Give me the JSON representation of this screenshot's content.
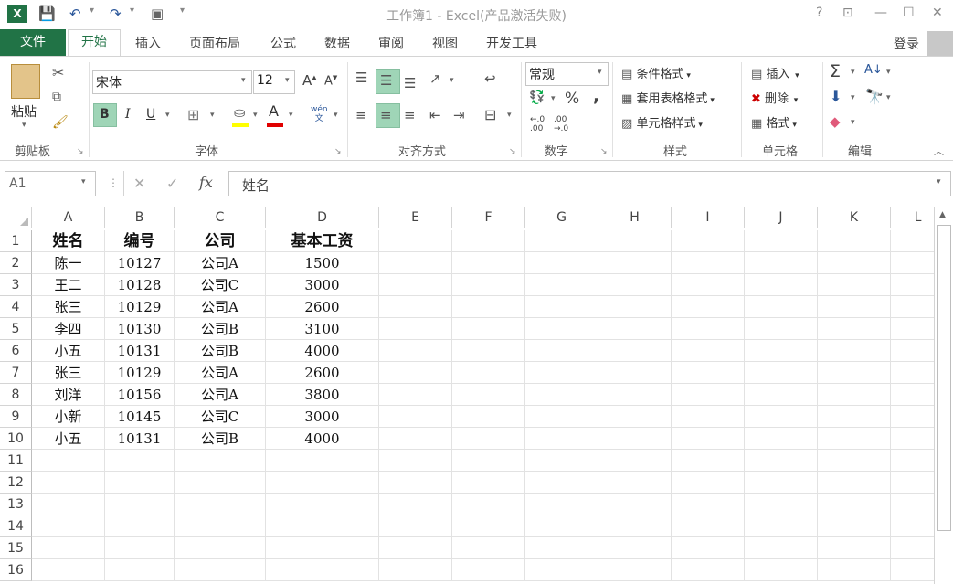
{
  "titlebar": {
    "title": "工作簿1 - Excel(产品激活失败)",
    "help": "?",
    "restore_ribbon": "⊡",
    "minimize": "—",
    "maximize": "☐",
    "close": "✕"
  },
  "quickaccess": {
    "app_icon": "excel-logo",
    "save": "save-icon",
    "undo": "undo-icon",
    "redo": "redo-icon",
    "camera": "camera-icon",
    "customize": "▾"
  },
  "tabs": {
    "file": "文件",
    "home": "开始",
    "insert": "插入",
    "page_layout": "页面布局",
    "formulas": "公式",
    "data": "数据",
    "review": "审阅",
    "view": "视图",
    "developer": "开发工具",
    "signin": "登录"
  },
  "ribbon": {
    "clipboard": {
      "label": "剪贴板",
      "paste": "粘贴"
    },
    "font": {
      "label": "字体",
      "font_name": "宋体",
      "font_size": "12",
      "bold": "B",
      "italic": "I",
      "underline": "U",
      "phonetic": "wén 文"
    },
    "alignment": {
      "label": "对齐方式"
    },
    "number": {
      "label": "数字",
      "format": "常规",
      "percent": "%",
      "comma": ","
    },
    "styles": {
      "label": "样式",
      "conditional": "条件格式",
      "table": "套用表格格式",
      "cell_styles": "单元格样式"
    },
    "cells": {
      "label": "单元格",
      "insert": "插入",
      "delete": "删除",
      "format": "格式"
    },
    "editing": {
      "label": "编辑"
    }
  },
  "formula": {
    "namebox": "A1",
    "cancel": "✕",
    "enter": "✓",
    "fx": "fx",
    "content": "姓名"
  },
  "columns": [
    "A",
    "B",
    "C",
    "D",
    "E",
    "F",
    "G",
    "H",
    "I",
    "J",
    "K",
    "L"
  ],
  "rows": [
    "1",
    "2",
    "3",
    "4",
    "5",
    "6",
    "7",
    "8",
    "9",
    "10",
    "11",
    "12",
    "13",
    "14",
    "15",
    "16"
  ],
  "table": {
    "headers": [
      "姓名",
      "编号",
      "公司",
      "基本工资"
    ],
    "data": [
      [
        "陈一",
        "10127",
        "公司A",
        "1500"
      ],
      [
        "王二",
        "10128",
        "公司C",
        "3000"
      ],
      [
        "张三",
        "10129",
        "公司A",
        "2600"
      ],
      [
        "李四",
        "10130",
        "公司B",
        "3100"
      ],
      [
        "小五",
        "10131",
        "公司B",
        "4000"
      ],
      [
        "张三",
        "10129",
        "公司A",
        "2600"
      ],
      [
        "刘洋",
        "10156",
        "公司A",
        "3800"
      ],
      [
        "小新",
        "10145",
        "公司C",
        "3000"
      ],
      [
        "小五",
        "10131",
        "公司B",
        "4000"
      ]
    ]
  },
  "colors": {
    "accent": "#217346",
    "selected": "#9fd5b7"
  }
}
